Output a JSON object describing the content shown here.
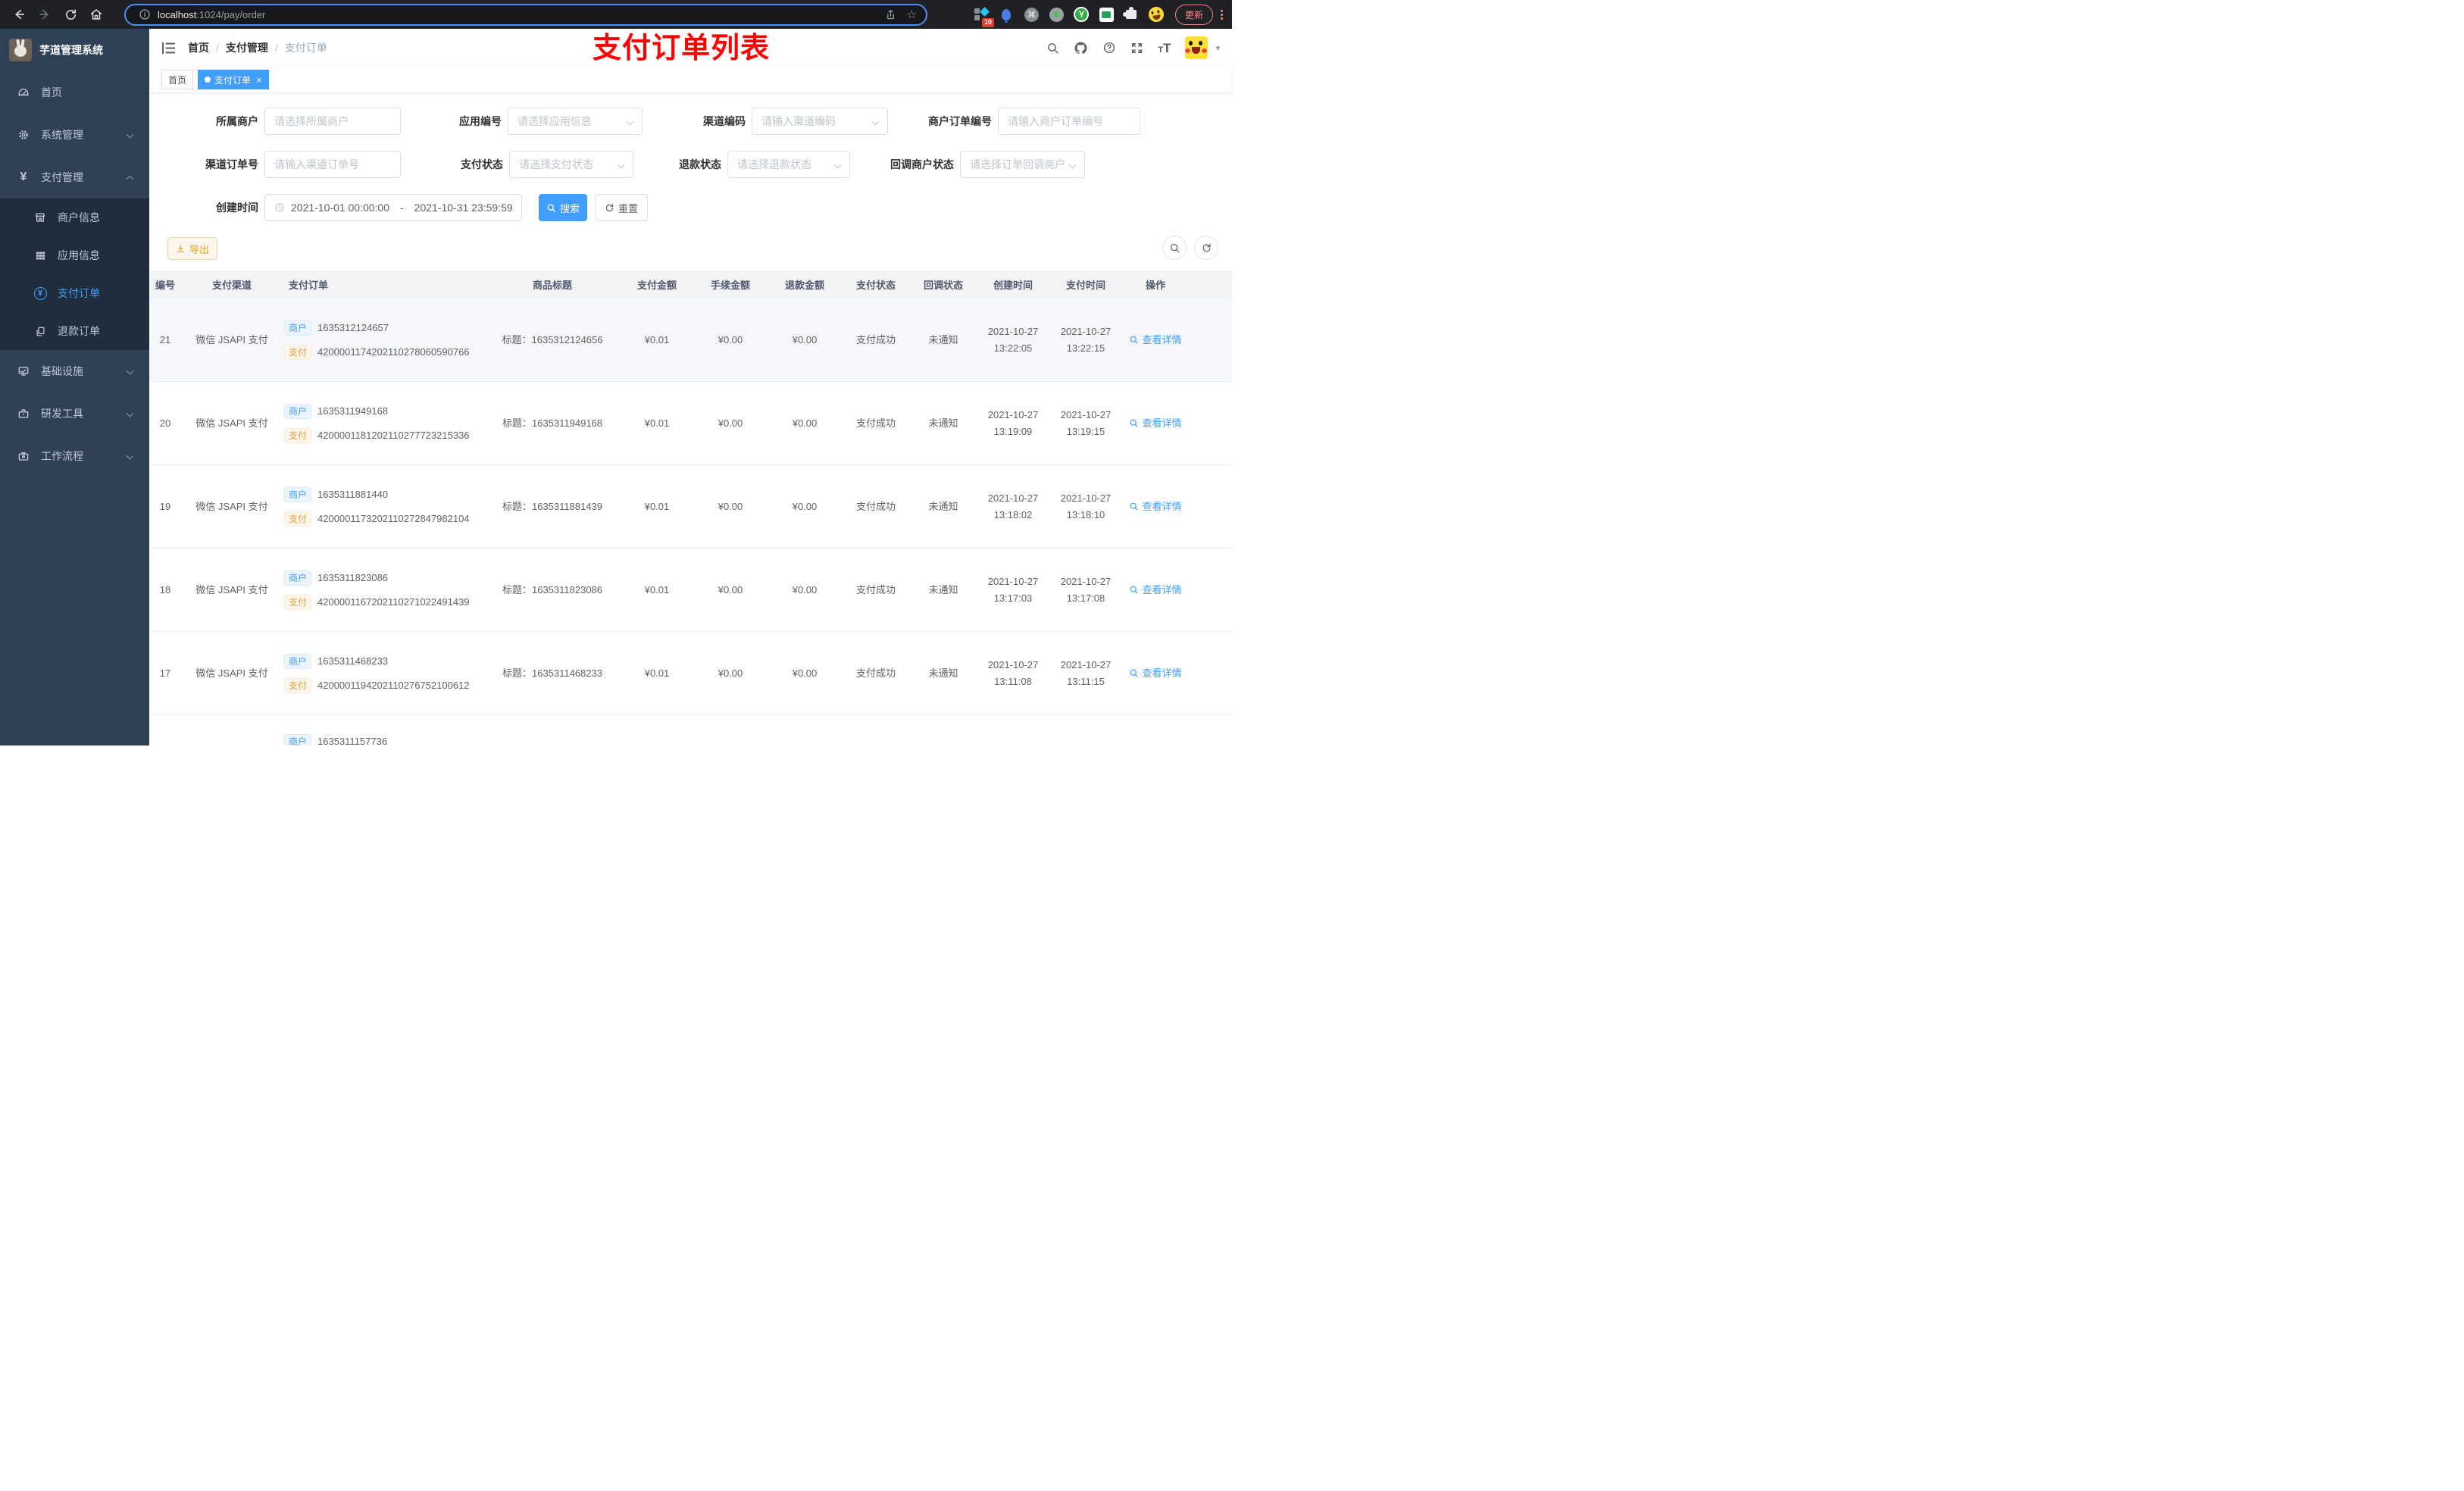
{
  "colors": {
    "accent": "#409EFF",
    "warning": "#E6A23C",
    "sidebar_bg": "#304156",
    "submenu_bg": "#1F2D3D",
    "annotation_red": "#FD0100",
    "chrome_bg": "#202124"
  },
  "glyphs": {
    "cmd": "⌘",
    "y_ext": "Y",
    "question": "?",
    "yen": "¥",
    "font_large": "T",
    "font_small": "T",
    "star": "☆",
    "caret": "▾",
    "close": "×"
  },
  "browser": {
    "url_host": "localhost",
    "url_rest": ":1024/pay/order",
    "ext_badge": "10",
    "update_label": "更新"
  },
  "sidebar": {
    "title": "芋道管理系统",
    "items": [
      {
        "label": "首页"
      },
      {
        "label": "系统管理"
      },
      {
        "label": "支付管理"
      },
      {
        "label": "商户信息"
      },
      {
        "label": "应用信息"
      },
      {
        "label": "支付订单"
      },
      {
        "label": "退款订单"
      },
      {
        "label": "基础设施"
      },
      {
        "label": "研发工具"
      },
      {
        "label": "工作流程"
      }
    ]
  },
  "navbar": {
    "breadcrumb": [
      "首页",
      "支付管理",
      "支付订单"
    ],
    "annotation": "支付订单列表"
  },
  "tags": {
    "home": "首页",
    "active": "支付订单"
  },
  "filters": {
    "merchant": {
      "label": "所属商户",
      "placeholder": "请选择所属商户"
    },
    "app": {
      "label": "应用编号",
      "placeholder": "请选择应用信息"
    },
    "channel_code": {
      "label": "渠道编码",
      "placeholder": "请输入渠道编码"
    },
    "merchant_order_no": {
      "label": "商户订单编号",
      "placeholder": "请输入商户订单编号"
    },
    "channel_order_no": {
      "label": "渠道订单号",
      "placeholder": "请输入渠道订单号"
    },
    "pay_status": {
      "label": "支付状态",
      "placeholder": "请选择支付状态"
    },
    "refund_status": {
      "label": "退款状态",
      "placeholder": "请选择退款状态"
    },
    "notify_status": {
      "label": "回调商户状态",
      "placeholder": "请选择订单回调商户状态"
    },
    "create_time": {
      "label": "创建时间",
      "start": "2021-10-01 00:00:00",
      "separator": "-",
      "end": "2021-10-31 23:59:59"
    },
    "search_label": "搜索",
    "reset_label": "重置"
  },
  "toolbar": {
    "export_label": "导出"
  },
  "table": {
    "headers": [
      "编号",
      "支付渠道",
      "支付订单",
      "商品标题",
      "支付金额",
      "手续金额",
      "退款金额",
      "支付状态",
      "回调状态",
      "创建时间",
      "支付时间",
      "操作"
    ],
    "tag_merchant": "商户",
    "tag_pay": "支付",
    "action_label": "查看详情",
    "rows": [
      {
        "no": "21",
        "channel": "微信 JSAPI 支付",
        "merchant_no": "1635312124657",
        "pay_no": "4200001174202110278060590766",
        "title": "标题：1635312124656",
        "amount": "¥0.01",
        "fee": "¥0.00",
        "refund": "¥0.00",
        "pay_status": "支付成功",
        "notify_status": "未通知",
        "create_date": "2021-10-27",
        "create_time": "13:22:05",
        "pay_date": "2021-10-27",
        "pay_time": "13:22:15"
      },
      {
        "no": "20",
        "channel": "微信 JSAPI 支付",
        "merchant_no": "1635311949168",
        "pay_no": "4200001181202110277723215336",
        "title": "标题：1635311949168",
        "amount": "¥0.01",
        "fee": "¥0.00",
        "refund": "¥0.00",
        "pay_status": "支付成功",
        "notify_status": "未通知",
        "create_date": "2021-10-27",
        "create_time": "13:19:09",
        "pay_date": "2021-10-27",
        "pay_time": "13:19:15"
      },
      {
        "no": "19",
        "channel": "微信 JSAPI 支付",
        "merchant_no": "1635311881440",
        "pay_no": "4200001173202110272847982104",
        "title": "标题：1635311881439",
        "amount": "¥0.01",
        "fee": "¥0.00",
        "refund": "¥0.00",
        "pay_status": "支付成功",
        "notify_status": "未通知",
        "create_date": "2021-10-27",
        "create_time": "13:18:02",
        "pay_date": "2021-10-27",
        "pay_time": "13:18:10"
      },
      {
        "no": "18",
        "channel": "微信 JSAPI 支付",
        "merchant_no": "1635311823086",
        "pay_no": "4200001167202110271022491439",
        "title": "标题：1635311823086",
        "amount": "¥0.01",
        "fee": "¥0.00",
        "refund": "¥0.00",
        "pay_status": "支付成功",
        "notify_status": "未通知",
        "create_date": "2021-10-27",
        "create_time": "13:17:03",
        "pay_date": "2021-10-27",
        "pay_time": "13:17:08"
      },
      {
        "no": "17",
        "channel": "微信 JSAPI 支付",
        "merchant_no": "1635311468233",
        "pay_no": "4200001194202110276752100612",
        "title": "标题：1635311468233",
        "amount": "¥0.01",
        "fee": "¥0.00",
        "refund": "¥0.00",
        "pay_status": "支付成功",
        "notify_status": "未通知",
        "create_date": "2021-10-27",
        "create_time": "13:11:08",
        "pay_date": "2021-10-27",
        "pay_time": "13:11:15"
      }
    ],
    "partial_row": {
      "merchant_no": "1635311157736"
    }
  }
}
